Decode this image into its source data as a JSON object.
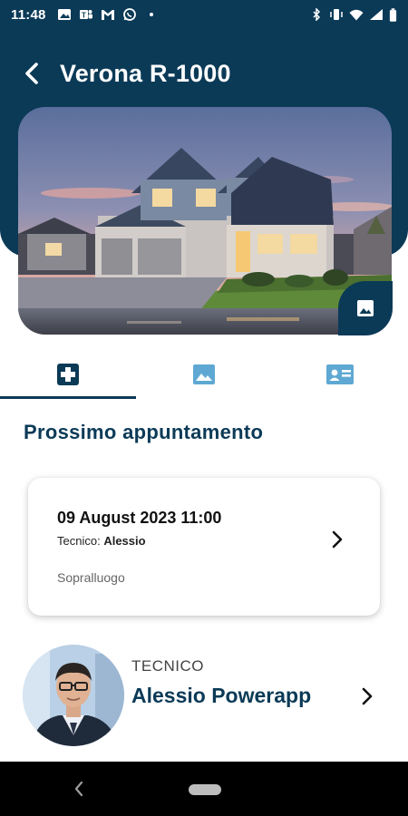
{
  "status_bar": {
    "time": "11:48",
    "left_icons": [
      "photo-icon",
      "teams-icon",
      "gmail-icon",
      "whatsapp-icon",
      "dot-icon"
    ],
    "right_icons": [
      "bluetooth-icon",
      "vibrate-icon",
      "wifi-icon",
      "signal-icon",
      "battery-icon"
    ]
  },
  "header": {
    "title": "Verona R-1000",
    "back_icon": "arrow-left-icon"
  },
  "hero": {
    "image": "house-photo",
    "photo_button_icon": "image-icon"
  },
  "tabs": [
    {
      "icon": "medical-cross-icon",
      "active": true
    },
    {
      "icon": "image-icon",
      "active": false
    },
    {
      "icon": "contact-card-icon",
      "active": false
    }
  ],
  "section": {
    "title": "Prossimo appuntamento"
  },
  "appointment": {
    "date": "09 August 2023 11:00",
    "tech_label": "Tecnico: ",
    "tech_name": "Alessio",
    "type": "Sopralluogo"
  },
  "technician": {
    "label": "TECNICO",
    "name": "Alessio Powerapp"
  },
  "colors": {
    "primary": "#0b3a57",
    "accent_light": "#5fa8d3"
  }
}
